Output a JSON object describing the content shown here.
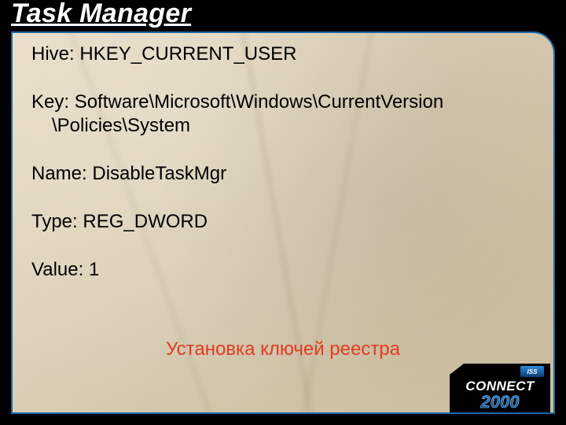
{
  "title": "Task Manager",
  "content": {
    "hive_label": "Hive: ",
    "hive_value": "HKEY_CURRENT_USER",
    "key_label": "Key: ",
    "key_line1": "Software\\Microsoft\\Windows\\CurrentVersion",
    "key_line2": "\\Policies\\System",
    "name_label": "Name: ",
    "name_value": "DisableTaskMgr",
    "type_label": "Type: ",
    "type_value": "REG_DWORD",
    "value_label": "Value: ",
    "value_value": "1"
  },
  "footer": "Установка ключей реестра",
  "logo": {
    "iss": "ISS",
    "connect": "CONNECT",
    "year": "2000"
  },
  "colors": {
    "frame_border": "#1d6aa5",
    "accent_red": "#e23b1f",
    "logo_blue_top": "#2f8bd8",
    "logo_blue_bottom": "#0a3e78"
  }
}
